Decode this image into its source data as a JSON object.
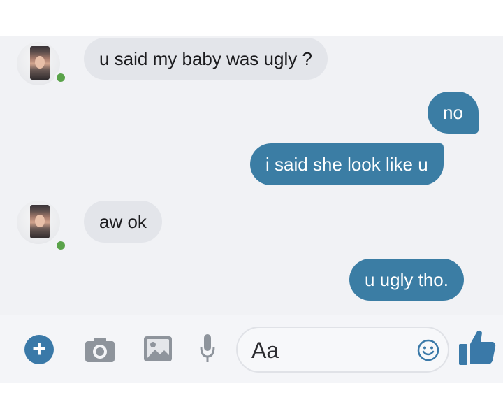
{
  "conversation": {
    "messages": [
      {
        "sender": "contact",
        "text": "u said my baby was ugly ?"
      },
      {
        "sender": "me",
        "text": "no"
      },
      {
        "sender": "me",
        "text": "i said she look like u"
      },
      {
        "sender": "contact",
        "text": "aw ok"
      },
      {
        "sender": "me",
        "text": "u ugly tho."
      }
    ]
  },
  "composer": {
    "placeholder": "Aa",
    "icons": [
      "plus-icon",
      "camera-icon",
      "image-icon",
      "microphone-icon",
      "emoji-icon",
      "thumbs-up-icon"
    ]
  },
  "colors": {
    "outgoing_bubble": "#3b7da4",
    "incoming_bubble": "#e3e5ea",
    "online_indicator": "#5aa34a",
    "accent": "#3a79a8"
  }
}
